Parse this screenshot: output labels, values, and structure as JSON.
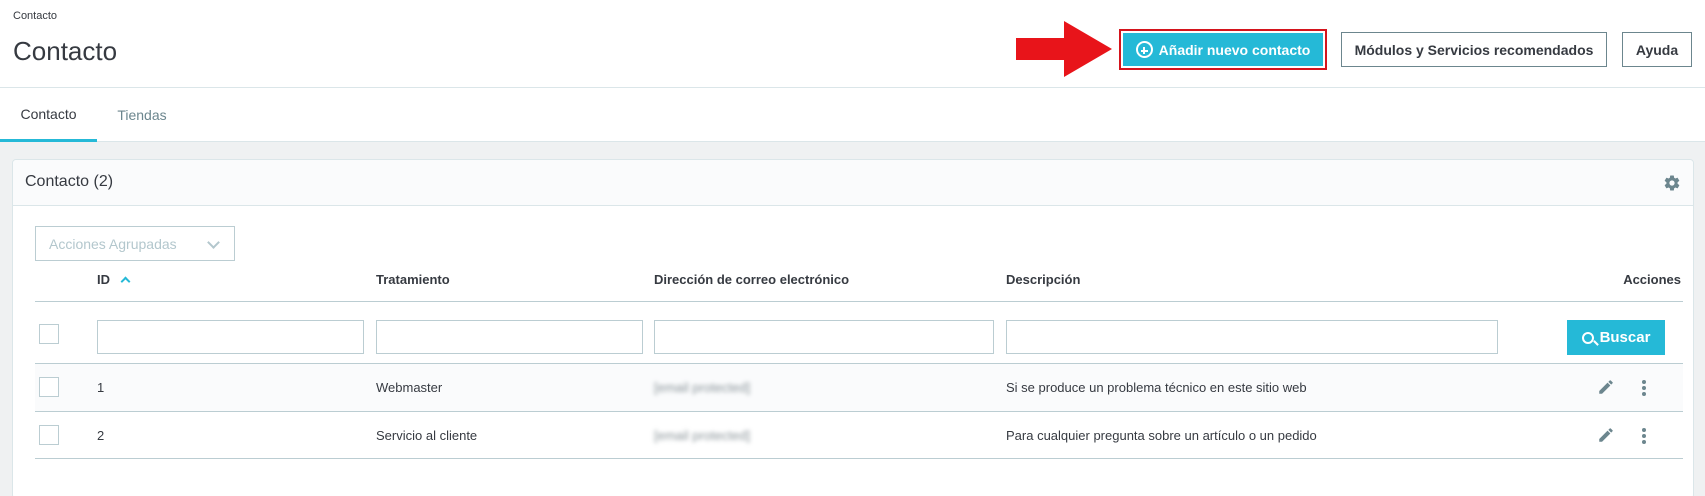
{
  "header": {
    "breadcrumb": "Contacto",
    "title": "Contacto",
    "add_button": "Añadir nuevo contacto",
    "modules_button": "Módulos y Servicios recomendados",
    "help_button": "Ayuda"
  },
  "tabs": [
    {
      "label": "Contacto",
      "active": true
    },
    {
      "label": "Tiendas",
      "active": false
    }
  ],
  "card": {
    "title": "Contacto (2)",
    "bulk_actions": "Acciones Agrupadas",
    "columns": [
      "ID",
      "Tratamiento",
      "Dirección de correo electrónico",
      "Descripción",
      "Acciones"
    ],
    "search_button": "Buscar",
    "rows": [
      {
        "id": "1",
        "title": "Webmaster",
        "email": "[email protected]",
        "description": "Si se produce un problema técnico en este sitio web"
      },
      {
        "id": "2",
        "title": "Servicio al cliente",
        "email": "[email protected]",
        "description": "Para cualquier pregunta sobre un artículo o un pedido"
      }
    ]
  },
  "colors": {
    "accent": "#25b9d7",
    "highlight_border": "#d4141d",
    "arrow": "#e8141a"
  }
}
